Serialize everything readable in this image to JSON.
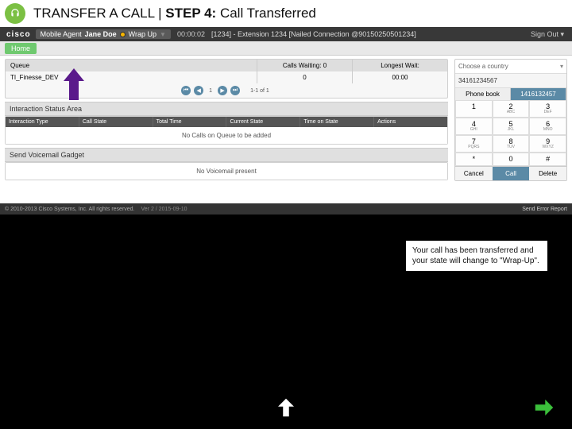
{
  "title": {
    "prefix": "TRANSFER A CALL | ",
    "step_label": "STEP 4:",
    "suffix": " Call Transferred"
  },
  "cisco_bar": {
    "logo": "cisco",
    "agent_label": "Mobile Agent ",
    "agent_name": "Jane Doe",
    "status": "Wrap Up",
    "timer": "00:00:02",
    "extension": "[1234] - Extension 1234 [Nailed Connection @90150250501234]",
    "sign_out": "Sign Out ▾"
  },
  "bar2": {
    "home": "Home"
  },
  "queue": {
    "headers": {
      "queue": "Queue",
      "calls": "Calls Waiting: 0",
      "wait": "Longest Wait:"
    },
    "row": {
      "name": "TI_Finesse_DEV",
      "calls": "0",
      "wait": "00:00"
    },
    "pager": {
      "first": "⏮",
      "prev": "◀",
      "page": "1",
      "next": "▶",
      "last": "⏭",
      "info": "1-1 of 1"
    }
  },
  "status_area": {
    "title": "Interaction Status Area",
    "cols": [
      "Interaction Type",
      "Call State",
      "Total Time",
      "Current State",
      "Time on State",
      "Actions"
    ],
    "empty": "No Calls on Queue to be added"
  },
  "voicemail": {
    "title": "Send Voicemail Gadget",
    "empty": "No Voicemail present"
  },
  "dialer": {
    "country_placeholder": "Choose a country",
    "number": "34161234567",
    "tabs": {
      "phonebook": "Phone book",
      "keypad": "1416132457"
    },
    "keys": [
      {
        "n": "1",
        "s": ""
      },
      {
        "n": "2",
        "s": "ABC"
      },
      {
        "n": "3",
        "s": "DEF"
      },
      {
        "n": "4",
        "s": "GHI"
      },
      {
        "n": "5",
        "s": "JKL"
      },
      {
        "n": "6",
        "s": "MNO"
      },
      {
        "n": "7",
        "s": "PQRS"
      },
      {
        "n": "8",
        "s": "TUV"
      },
      {
        "n": "9",
        "s": "WXYZ"
      },
      {
        "n": "*",
        "s": ""
      },
      {
        "n": "0",
        "s": ""
      },
      {
        "n": "#",
        "s": ""
      }
    ],
    "actions": {
      "cancel": "Cancel",
      "call": "Call",
      "delete": "Delete"
    }
  },
  "footer": {
    "copyright": "© 2010-2013 Cisco Systems, Inc. All rights reserved.",
    "version": "Ver 2 / 2015-09-10",
    "report": "Send Error Report"
  },
  "callout": "Your call has been transferred and your state will change to \"Wrap-Up\"."
}
